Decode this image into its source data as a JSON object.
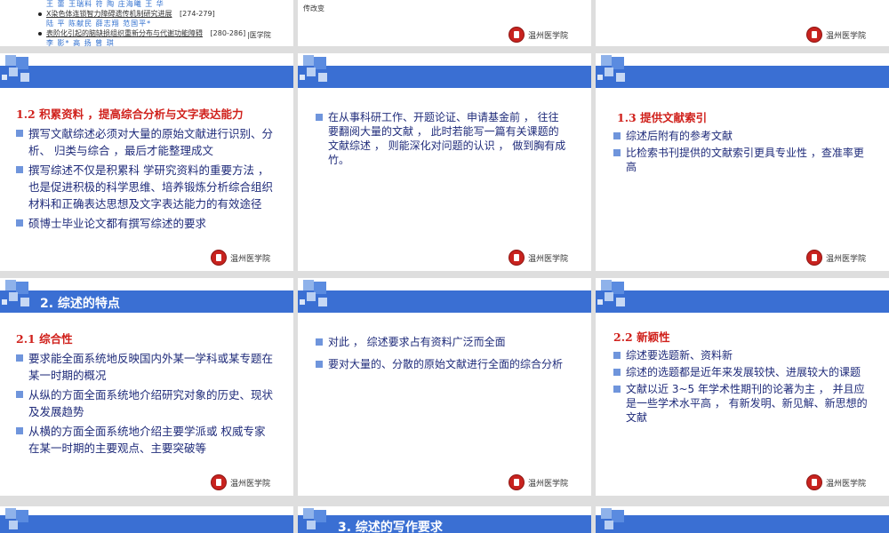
{
  "logo": {
    "text": "温州医学院"
  },
  "top_row": {
    "left": {
      "authors1": "王 蕾  王瑞料  符 陶  庄海曦  王 华",
      "ref1_title": "X染色体连锁智力障碍遗传机制研究进展",
      "ref1_pages": "[274-279]",
      "authors2": "陆 平  陈献民  薛志翔  范国平*",
      "ref2_title": "表阶化引起的脑缺损组织重新分布与代谢功能障碍",
      "ref2_pages": "[280-286]",
      "authors3": "李 影*  高 扬  曾 琪",
      "fragment": "|医学院"
    },
    "middle": {
      "fragment": "传改变"
    }
  },
  "slide_1_2": {
    "subhead": "1.2  积累资料 ，提高综合分析与文字表达能力",
    "bullets": [
      "撰写文献综述必须对大量的原始文献进行识别、分析、  归类与综合 ，最后才能整理成文",
      "撰写综述不仅是积累科 学研究资料的重要方法 ，也是促进积极的科学思维、培养锻炼分析综合组织材料和正确表达思想及文字表达能力的有效途径",
      "硕博士毕业论文都有撰写综述的要求"
    ]
  },
  "slide_research": {
    "bullets": [
      "在从事科研工作、开题论证、申请基金前 ， 往往要翻阅大量的文献 ， 此时若能写一篇有关课题的文献综述 ， 则能深化对问题的认识 ， 做到胸有成竹。"
    ]
  },
  "slide_1_3": {
    "subhead": "1.3  提供文献索引",
    "bullets": [
      "综述后附有的参考文献",
      "比检索书刊提供的文献索引更具专业性 ，查准率更高"
    ]
  },
  "slide_2_1": {
    "band_title": "2.  综述的特点",
    "subhead": "2.1  综合性",
    "bullets": [
      "要求能全面系统地反映国内外某一学科或某专题在某一时期的概况",
      "从纵的方面全面系统地介绍研究对象的历史、现状  及发展趋势",
      "从横的方面全面系统地介绍主要学派或 权威专家在某一时期的主要观点、主要突破等"
    ]
  },
  "slide_scope": {
    "bullets": [
      "对此 ，  综述要求占有资料广泛而全面",
      "要对大量的、分散的原始文献进行全面的综合分析"
    ]
  },
  "slide_2_2": {
    "subhead": "2.2  新颖性",
    "bullets": [
      "综述要选题新、资料新",
      "综述的选题都是近年来发展较快、进展较大的课题",
      "文献以近  3~5  年学术性期刊的论著为主 ，  并且应是一些学术水平高 ，  有新发明、新见解、新思想的文献"
    ]
  },
  "bottom_row": {
    "middle_title": "3.  综述的写作要求"
  }
}
